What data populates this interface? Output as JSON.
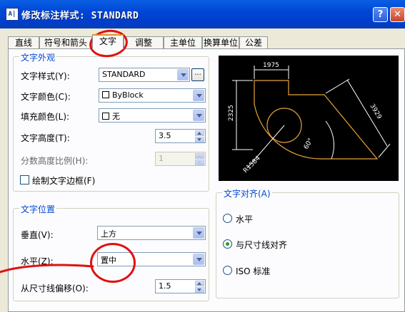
{
  "window": {
    "icon_text": "A|",
    "title": "修改标注样式: STANDARD",
    "help_label": "?",
    "close_label": "✕"
  },
  "tabs": [
    {
      "label": "直线",
      "active": false
    },
    {
      "label": "符号和箭头",
      "active": false
    },
    {
      "label": "文字",
      "active": true
    },
    {
      "label": "调整",
      "active": false
    },
    {
      "label": "主单位",
      "active": false
    },
    {
      "label": "换算单位",
      "active": false
    },
    {
      "label": "公差",
      "active": false
    }
  ],
  "text_appearance": {
    "title": "文字外观",
    "style_label": "文字样式(Y):",
    "style_value": "STANDARD",
    "browse_label": "...",
    "color_label": "文字颜色(C):",
    "color_value": "ByBlock",
    "fill_label": "填充颜色(L):",
    "fill_value": "无",
    "height_label": "文字高度(T):",
    "height_value": "3.5",
    "fraction_label": "分数高度比例(H):",
    "fraction_value": "1",
    "frame_label": "绘制文字边框(F)",
    "frame_checked": false
  },
  "text_placement": {
    "title": "文字位置",
    "vertical_label": "垂直(V):",
    "vertical_value": "上方",
    "horizontal_label": "水平(Z):",
    "horizontal_value": "置中",
    "offset_label": "从尺寸线偏移(O):",
    "offset_value": "1.5"
  },
  "text_alignment": {
    "title": "文字对齐(A)",
    "options": [
      {
        "label": "水平",
        "checked": false
      },
      {
        "label": "与尺寸线对齐",
        "checked": true
      },
      {
        "label": "ISO 标准",
        "checked": false
      }
    ]
  },
  "preview": {
    "dim_top": "1975",
    "dim_left": "2325",
    "dim_right": "3929",
    "dim_angle": "60°",
    "dim_radius": "R1584",
    "colors": {
      "geometry": "#E8A23C",
      "dimensions": "#FFFFFF"
    }
  },
  "annotation_color": "#E01010"
}
